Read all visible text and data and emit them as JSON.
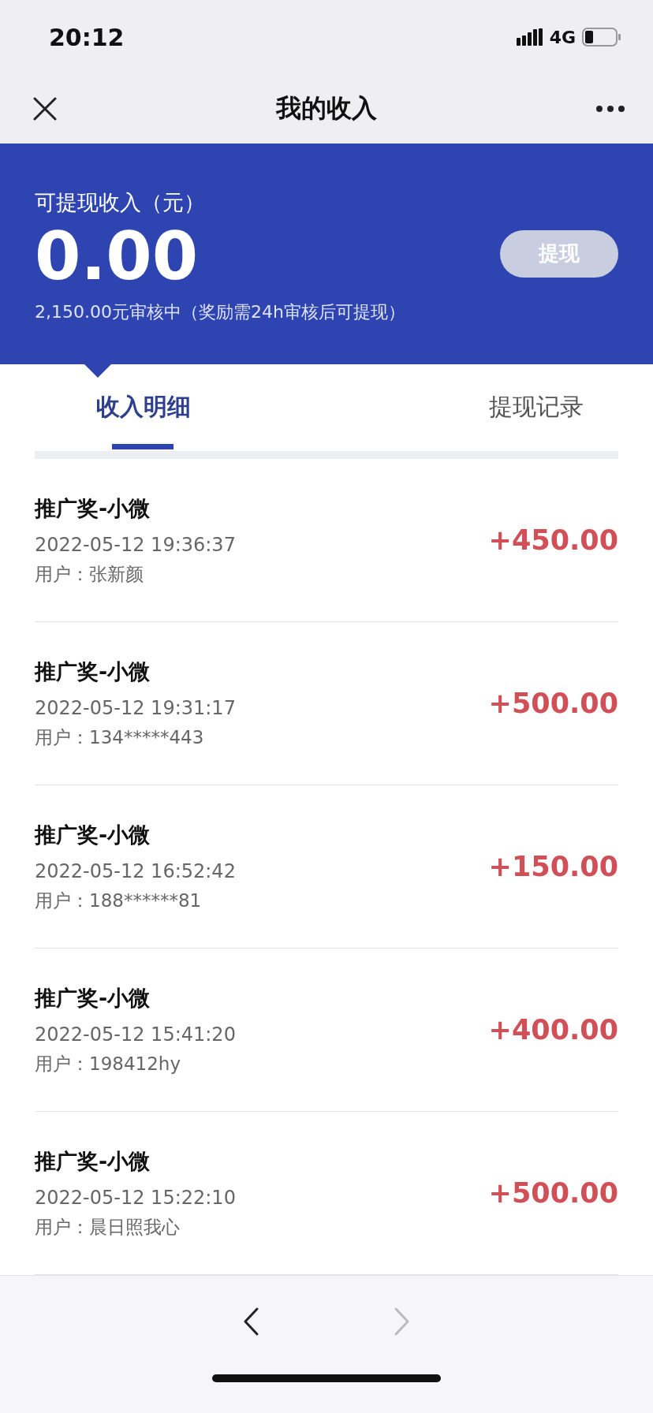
{
  "status_bar": {
    "time": "20:12",
    "network": "4G"
  },
  "nav": {
    "title": "我的收入"
  },
  "balance": {
    "label": "可提现收入（元）",
    "amount": "0.00",
    "note": "2,150.00元审核中（奖励需24h审核后可提现）",
    "button": {
      "label": "提现",
      "disabled": true
    }
  },
  "tabs": [
    {
      "label": "收入明细",
      "selected": true
    },
    {
      "label": "提现记录",
      "selected": false
    }
  ],
  "records": [
    {
      "title": "推广奖-小微",
      "time": "2022-05-12 19:36:37",
      "user": "用户：张新颜",
      "amount": "+450.00"
    },
    {
      "title": "推广奖-小微",
      "time": "2022-05-12 19:31:17",
      "user": "用户：134*****443",
      "amount": "+500.00"
    },
    {
      "title": "推广奖-小微",
      "time": "2022-05-12 16:52:42",
      "user": "用户：188******81",
      "amount": "+150.00"
    },
    {
      "title": "推广奖-小微",
      "time": "2022-05-12 15:41:20",
      "user": "用户：198412hy",
      "amount": "+400.00"
    },
    {
      "title": "推广奖-小微",
      "time": "2022-05-12 15:22:10",
      "user": "用户：晨日照我心",
      "amount": "+500.00"
    }
  ],
  "toolbar": {
    "back_disabled": false,
    "forward_disabled": true
  }
}
